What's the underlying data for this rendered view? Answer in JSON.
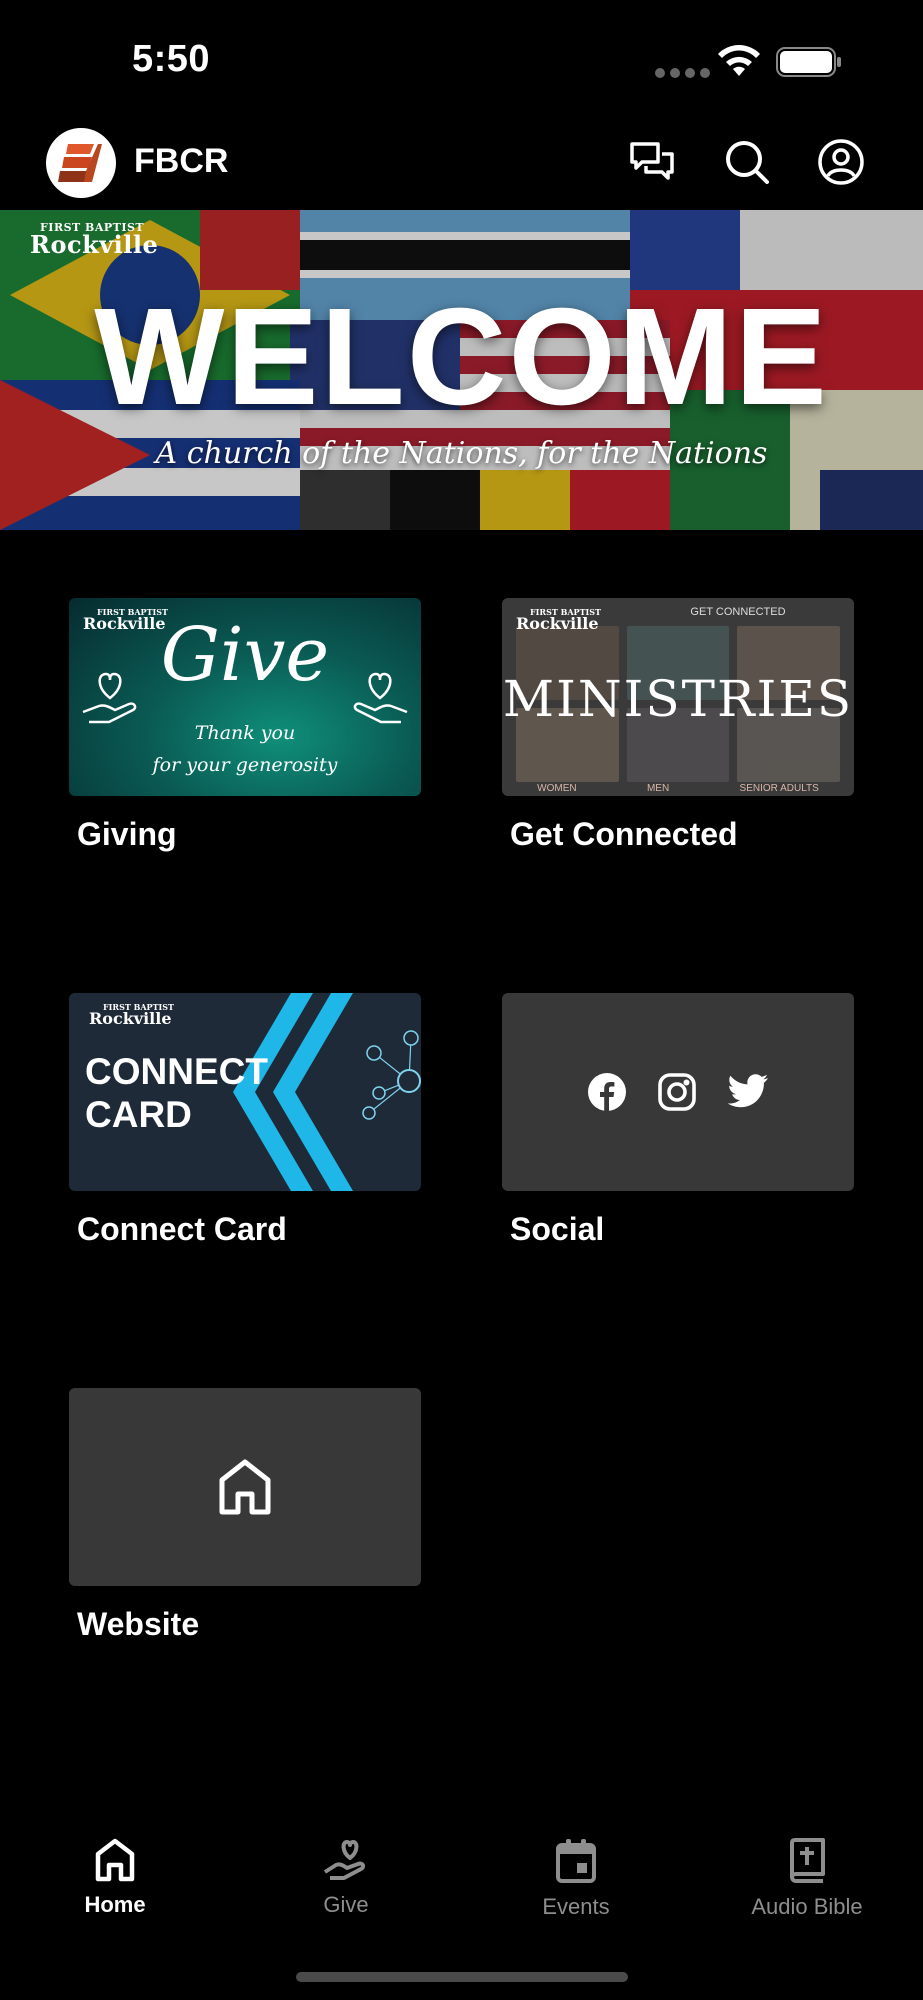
{
  "status_bar": {
    "time": "5:50"
  },
  "header": {
    "title": "FBCR",
    "logo_icon": "church-steps-logo",
    "actions": [
      "chat-icon",
      "search-icon",
      "profile-icon"
    ]
  },
  "banner": {
    "brand_line1": "FIRST BAPTIST",
    "brand_line2": "Rockville",
    "title": "WELCOME",
    "subtitle": "A church of the Nations, for the Nations"
  },
  "tiles": [
    {
      "label": "Giving",
      "image": {
        "brand_line1": "FIRST BAPTIST",
        "brand_line2": "Rockville",
        "script": "Give",
        "line1": "Thank you",
        "line2": "for your generosity"
      }
    },
    {
      "label": "Get Connected",
      "image": {
        "brand_line1": "FIRST BAPTIST",
        "brand_line2": "Rockville",
        "top": "GET CONNECTED",
        "word": "MINISTRIES",
        "bottom": [
          "WOMEN",
          "MEN",
          "SENIOR ADULTS"
        ]
      }
    },
    {
      "label": "Connect Card",
      "image": {
        "brand_line1": "FIRST BAPTIST",
        "brand_line2": "Rockville",
        "line1": "CONNECT",
        "line2": "CARD"
      }
    },
    {
      "label": "Social",
      "image": {
        "icons": [
          "facebook-icon",
          "instagram-icon",
          "twitter-icon"
        ]
      }
    },
    {
      "label": "Website",
      "image": {
        "icons": [
          "home-icon"
        ]
      }
    }
  ],
  "tabbar": {
    "tabs": [
      {
        "label": "Home",
        "icon": "home-icon",
        "active": true
      },
      {
        "label": "Give",
        "icon": "give-hand-heart-icon",
        "active": false
      },
      {
        "label": "Events",
        "icon": "calendar-icon",
        "active": false
      },
      {
        "label": "Audio Bible",
        "icon": "bible-icon",
        "active": false
      }
    ]
  },
  "colors": {
    "background": "#000000",
    "tile_placeholder": "#383838",
    "tab_inactive": "#8e8e8e",
    "give_teal": "#0a5a53",
    "connect_card_navy": "#1f2a38",
    "connect_card_accent": "#1fb6e8"
  }
}
